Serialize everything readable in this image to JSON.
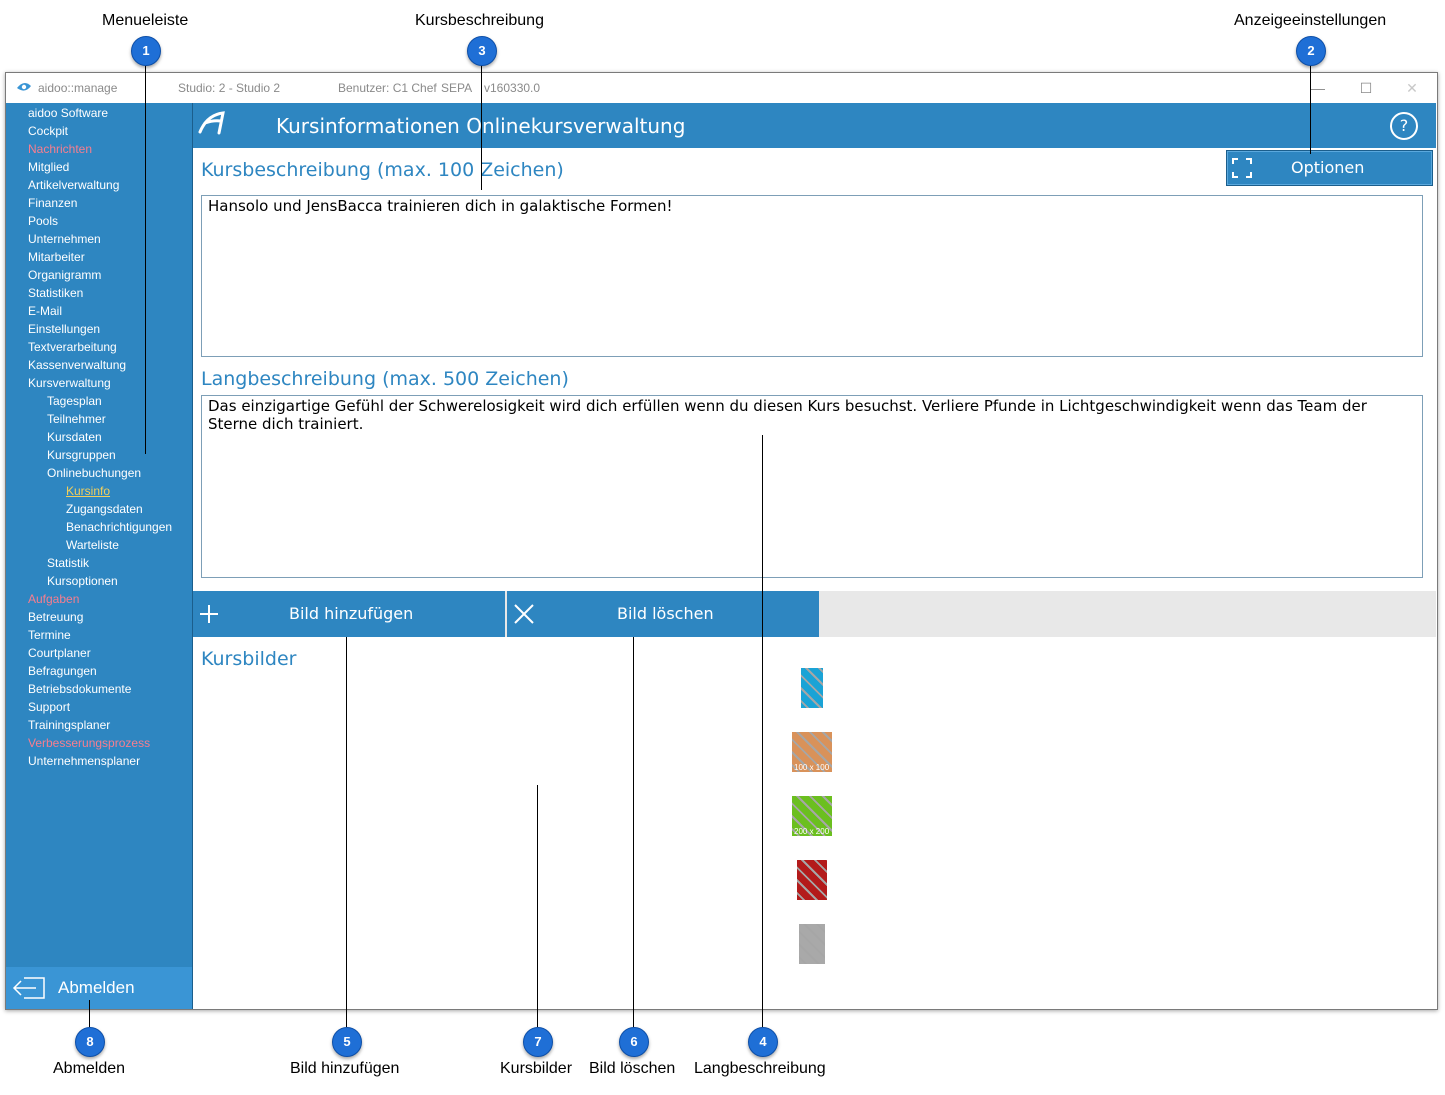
{
  "annotations": {
    "menueleiste": {
      "number": "1",
      "label": "Menueleiste"
    },
    "anzeigeeinstellungen": {
      "number": "2",
      "label": "Anzeigeeinstellungen"
    },
    "kursbeschreibung": {
      "number": "3",
      "label": "Kursbeschreibung"
    },
    "langbeschreibung": {
      "number": "4",
      "label": "Langbeschreibung"
    },
    "bild_hinzufuegen": {
      "number": "5",
      "label": "Bild hinzufügen"
    },
    "bild_loeschen": {
      "number": "6",
      "label": "Bild löschen"
    },
    "kursbilder": {
      "number": "7",
      "label": "Kursbilder"
    },
    "abmelden": {
      "number": "8",
      "label": "Abmelden"
    }
  },
  "titlebar": {
    "app_name": "aidoo::manage",
    "studio": "Studio: 2 - Studio 2",
    "user": "Benutzer: C1 Chef",
    "sepa": "SEPA",
    "version": "v160330.0",
    "minimize": "—",
    "maximize": "☐",
    "close": "✕"
  },
  "sidebar": {
    "items": [
      {
        "label": "aidoo Software",
        "level": 0,
        "style": "normal"
      },
      {
        "label": "Cockpit",
        "level": 0,
        "style": "normal"
      },
      {
        "label": "Nachrichten",
        "level": 0,
        "style": "red"
      },
      {
        "label": "Mitglied",
        "level": 0,
        "style": "normal"
      },
      {
        "label": "Artikelverwaltung",
        "level": 0,
        "style": "normal"
      },
      {
        "label": "Finanzen",
        "level": 0,
        "style": "normal"
      },
      {
        "label": "Pools",
        "level": 0,
        "style": "normal"
      },
      {
        "label": "Unternehmen",
        "level": 0,
        "style": "normal"
      },
      {
        "label": "Mitarbeiter",
        "level": 0,
        "style": "normal"
      },
      {
        "label": "Organigramm",
        "level": 0,
        "style": "normal"
      },
      {
        "label": "Statistiken",
        "level": 0,
        "style": "normal"
      },
      {
        "label": "E-Mail",
        "level": 0,
        "style": "normal"
      },
      {
        "label": "Einstellungen",
        "level": 0,
        "style": "normal"
      },
      {
        "label": "Textverarbeitung",
        "level": 0,
        "style": "normal"
      },
      {
        "label": "Kassenverwaltung",
        "level": 0,
        "style": "normal"
      },
      {
        "label": "Kursverwaltung",
        "level": 0,
        "style": "normal"
      },
      {
        "label": "Tagesplan",
        "level": 1,
        "style": "normal"
      },
      {
        "label": "Teilnehmer",
        "level": 1,
        "style": "normal"
      },
      {
        "label": "Kursdaten",
        "level": 1,
        "style": "normal"
      },
      {
        "label": "Kursgruppen",
        "level": 1,
        "style": "normal"
      },
      {
        "label": "Onlinebuchungen",
        "level": 1,
        "style": "normal"
      },
      {
        "label": "Kursinfo",
        "level": 2,
        "style": "active"
      },
      {
        "label": "Zugangsdaten",
        "level": 2,
        "style": "normal"
      },
      {
        "label": "Benachrichtigungen",
        "level": 2,
        "style": "normal"
      },
      {
        "label": "Warteliste",
        "level": 2,
        "style": "normal"
      },
      {
        "label": "Statistik",
        "level": 1,
        "style": "normal"
      },
      {
        "label": "Kursoptionen",
        "level": 1,
        "style": "normal"
      },
      {
        "label": "Aufgaben",
        "level": 0,
        "style": "red"
      },
      {
        "label": "Betreuung",
        "level": 0,
        "style": "normal"
      },
      {
        "label": "Termine",
        "level": 0,
        "style": "normal"
      },
      {
        "label": "Courtplaner",
        "level": 0,
        "style": "normal"
      },
      {
        "label": "Befragungen",
        "level": 0,
        "style": "normal"
      },
      {
        "label": "Betriebsdokumente",
        "level": 0,
        "style": "normal"
      },
      {
        "label": "Support",
        "level": 0,
        "style": "normal"
      },
      {
        "label": "Trainingsplaner",
        "level": 0,
        "style": "normal"
      },
      {
        "label": "Verbesserungsprozess",
        "level": 0,
        "style": "red"
      },
      {
        "label": "Unternehmensplaner",
        "level": 0,
        "style": "normal"
      }
    ],
    "logout_label": "Abmelden"
  },
  "header": {
    "title": "Kursinformationen Onlinekursverwaltung",
    "help": "?"
  },
  "kursbeschreibung": {
    "title": "Kursbeschreibung (max. 100 Zeichen)",
    "value": "Hansolo und JensBacca trainieren dich in galaktische Formen!"
  },
  "options_button": {
    "label": "Optionen"
  },
  "langbeschreibung": {
    "title": "Langbeschreibung (max. 500 Zeichen)",
    "value": "Das einzigartige Gefühl der Schwerelosigkeit wird dich erfüllen wenn du diesen Kurs besuchst. Verliere Pfunde in Lichtgeschwindigkeit wenn das Team der Sterne dich trainiert."
  },
  "toolbar": {
    "add_label": "Bild hinzufügen",
    "delete_label": "Bild löschen"
  },
  "kursbilder": {
    "title": "Kursbilder",
    "images": [
      {
        "caption": "",
        "color": "#1aa3d6"
      },
      {
        "caption": "100 x 100",
        "color": "#d9925a"
      },
      {
        "caption": "200 x 200",
        "color": "#6bbf1f"
      },
      {
        "caption": "",
        "color": "#b31b1b"
      },
      {
        "caption": "",
        "color": "#a9a9a9"
      }
    ]
  },
  "colors": {
    "accent": "#2e86c1",
    "menu_red": "#f77e8f",
    "menu_active": "#f2cf5b",
    "badge": "#1f6fd6"
  }
}
